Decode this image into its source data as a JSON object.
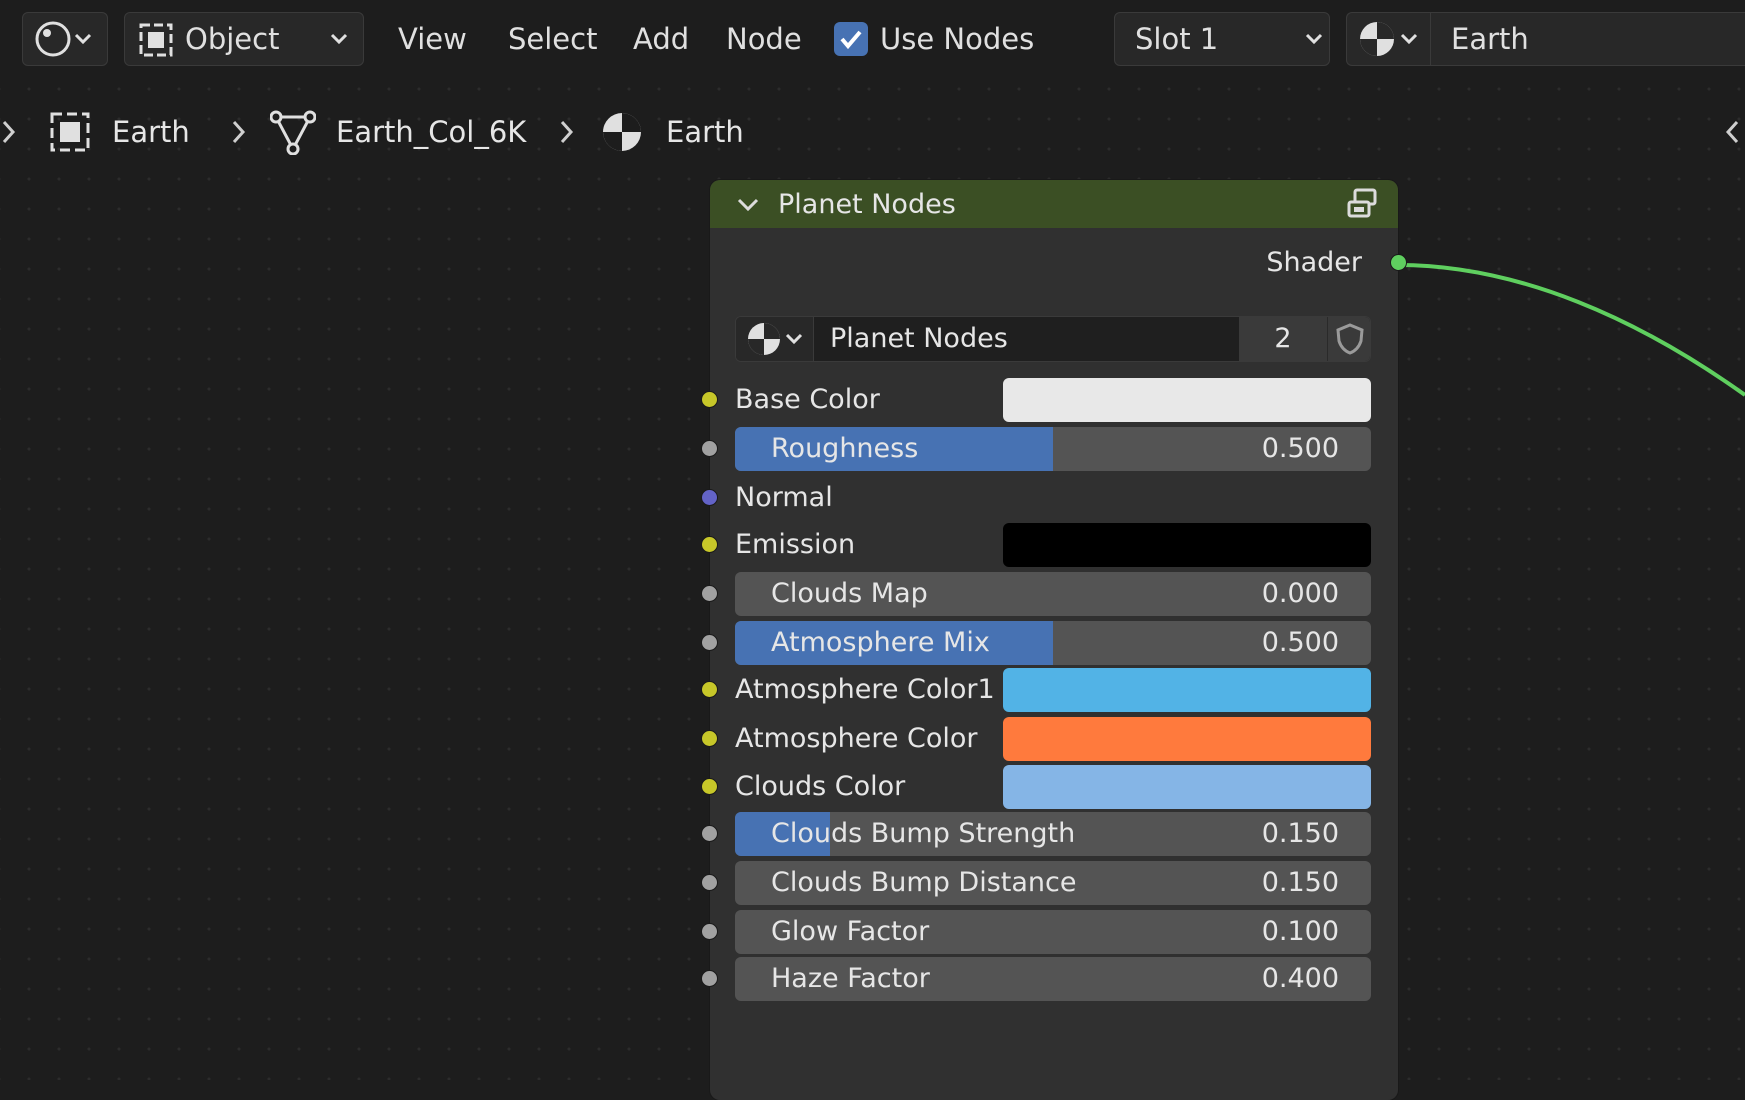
{
  "header": {
    "mode": {
      "icon": "editor-type-icon",
      "chevron": "chevron-down-icon"
    },
    "object_selector": {
      "label": "Object",
      "icon": "object-icon"
    },
    "menus": [
      "View",
      "Select",
      "Add",
      "Node"
    ],
    "use_nodes": {
      "label": "Use Nodes",
      "checked": true
    },
    "slot": {
      "label": "Slot 1"
    },
    "material": {
      "label": "Earth",
      "icon": "material-icon"
    }
  },
  "breadcrumb": {
    "items": [
      {
        "icon": "object-icon",
        "label": "Earth"
      },
      {
        "icon": "mesh-icon",
        "label": "Earth_Col_6K"
      },
      {
        "icon": "material-icon",
        "label": "Earth"
      }
    ]
  },
  "node": {
    "title": "Planet Nodes",
    "output": {
      "label": "Shader",
      "color": "#5fcf5f"
    },
    "group": {
      "name": "Planet Nodes",
      "users": "2"
    },
    "inputs": [
      {
        "label": "Base Color",
        "kind": "color",
        "value_color": "#e8e8e8",
        "socket": "#c7c729"
      },
      {
        "label": "Roughness",
        "kind": "slider",
        "value": "0.500",
        "fraction": 0.5,
        "socket": "#a1a1a1"
      },
      {
        "label": "Normal",
        "kind": "vector",
        "socket": "#6363c7"
      },
      {
        "label": "Emission",
        "kind": "color",
        "value_color": "#000000",
        "socket": "#c7c729"
      },
      {
        "label": "Clouds Map",
        "kind": "slider",
        "value": "0.000",
        "fraction": 0.0,
        "socket": "#a1a1a1"
      },
      {
        "label": "Atmosphere Mix",
        "kind": "slider",
        "value": "0.500",
        "fraction": 0.5,
        "socket": "#a1a1a1"
      },
      {
        "label": "Atmosphere Color1",
        "kind": "color",
        "value_color": "#52b3e6",
        "socket": "#c7c729"
      },
      {
        "label": "Atmosphere Color",
        "kind": "color",
        "value_color": "#ff7a3d",
        "socket": "#c7c729"
      },
      {
        "label": "Clouds Color",
        "kind": "color",
        "value_color": "#85b5e6",
        "socket": "#c7c729"
      },
      {
        "label": "Clouds Bump Strength",
        "kind": "slider",
        "value": "0.150",
        "fraction": 0.15,
        "socket": "#a1a1a1"
      },
      {
        "label": "Clouds Bump Distance",
        "kind": "slider",
        "value": "0.150",
        "fraction": 0.0,
        "socket": "#a1a1a1"
      },
      {
        "label": "Glow Factor",
        "kind": "slider",
        "value": "0.100",
        "fraction": 0.0,
        "socket": "#a1a1a1"
      },
      {
        "label": "Haze Factor",
        "kind": "slider",
        "value": "0.400",
        "fraction": 0.0,
        "socket": "#a1a1a1"
      }
    ]
  },
  "colors": {
    "accent": "#4772b3",
    "node_header": "#3b4f24",
    "node_body": "#303030",
    "link": "#5fcf5f"
  }
}
